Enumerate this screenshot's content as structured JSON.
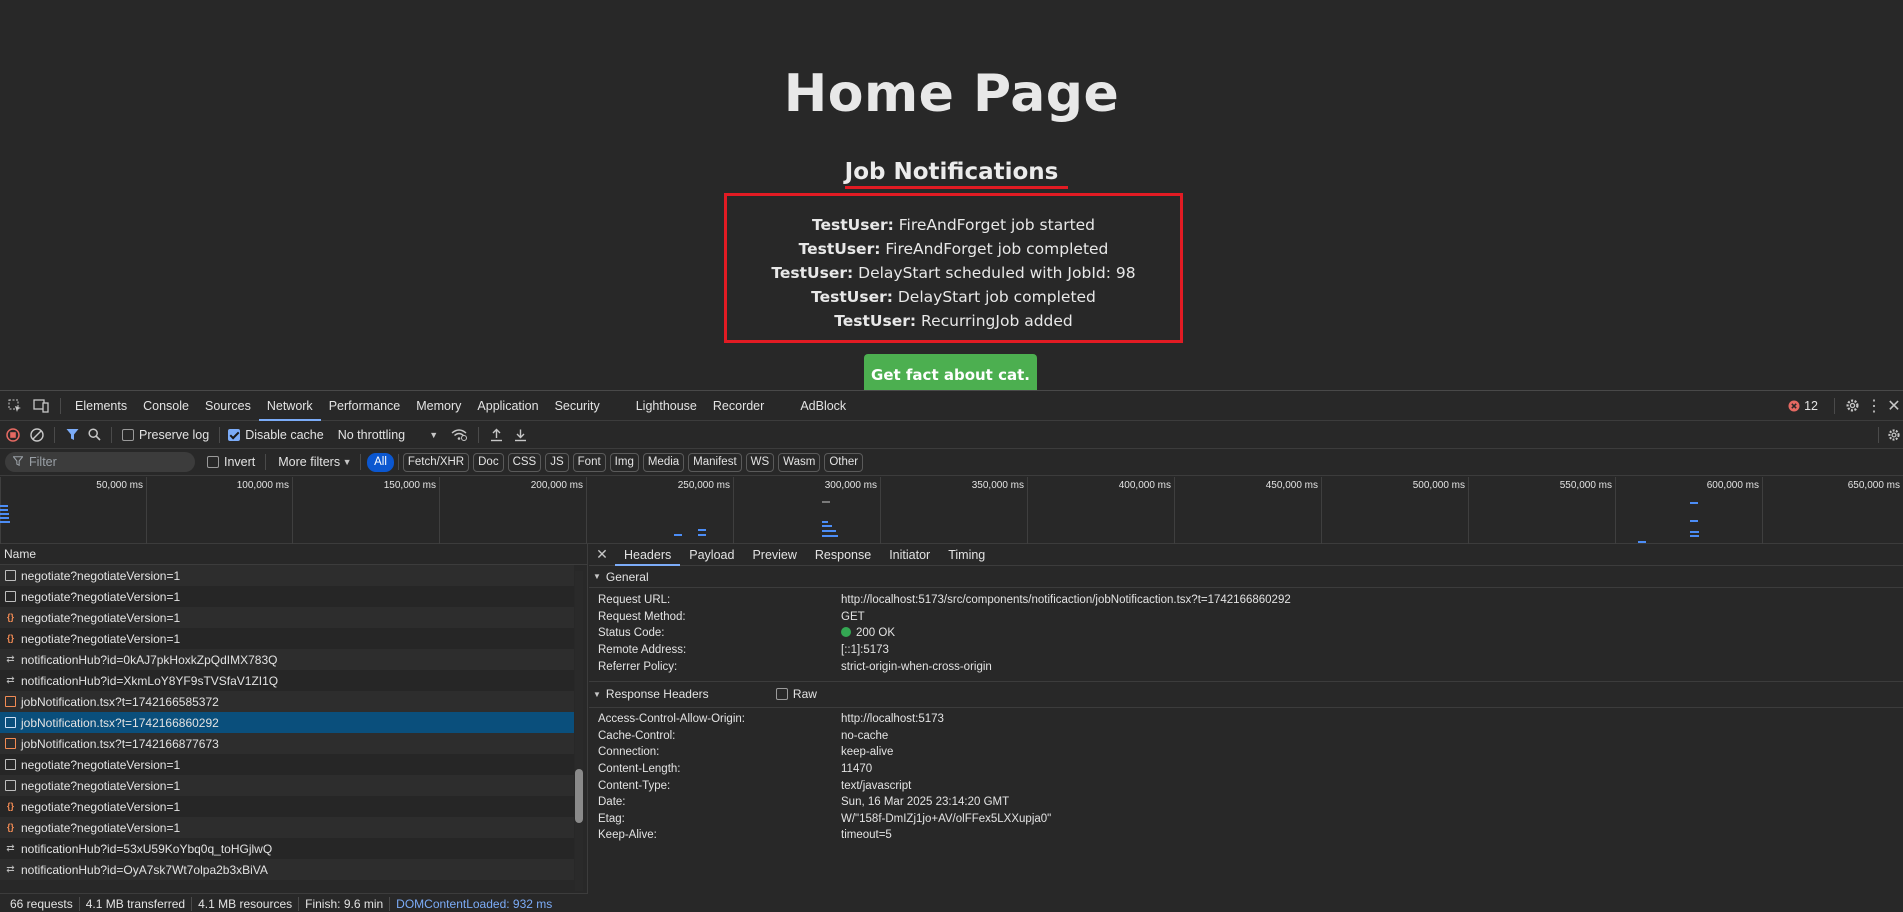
{
  "webpage": {
    "title": "Home Page",
    "subtitle": "Job Notifications",
    "notifications": [
      {
        "user": "TestUser:",
        "message": " FireAndForget job started"
      },
      {
        "user": "TestUser:",
        "message": " FireAndForget job completed"
      },
      {
        "user": "TestUser:",
        "message": " DelayStart scheduled with JobId: 98"
      },
      {
        "user": "TestUser:",
        "message": " DelayStart job completed"
      },
      {
        "user": "TestUser:",
        "message": " RecurringJob added"
      }
    ],
    "cat_button_label": "Get fact about cat.",
    "accent_button_color": "#4caf50",
    "highlight_color": "#e21b23"
  },
  "devtools": {
    "tabs": [
      "Elements",
      "Console",
      "Sources",
      "Network",
      "Performance",
      "Memory",
      "Application",
      "Security",
      "Lighthouse",
      "Recorder",
      "AdBlock"
    ],
    "active_tab": "Network",
    "error_count": "12",
    "toolbar": {
      "preserve_log": "Preserve log",
      "preserve_log_checked": false,
      "disable_cache": "Disable cache",
      "disable_cache_checked": true,
      "throttling": "No throttling"
    },
    "filter": {
      "placeholder": "Filter",
      "invert": "Invert",
      "more_filters": "More filters",
      "types": [
        "All",
        "Fetch/XHR",
        "Doc",
        "CSS",
        "JS",
        "Font",
        "Img",
        "Media",
        "Manifest",
        "WS",
        "Wasm",
        "Other"
      ],
      "active_type": "All"
    },
    "timeline_ticks": [
      "50,000 ms",
      "100,000 ms",
      "150,000 ms",
      "200,000 ms",
      "250,000 ms",
      "300,000 ms",
      "350,000 ms",
      "400,000 ms",
      "450,000 ms",
      "500,000 ms",
      "550,000 ms",
      "600,000 ms",
      "650,000 ms"
    ],
    "request_list": {
      "header": "Name",
      "rows": [
        {
          "name": "negotiate?negotiateVersion=1",
          "icon": "document-icon"
        },
        {
          "name": "negotiate?negotiateVersion=1",
          "icon": "document-icon"
        },
        {
          "name": "negotiate?negotiateVersion=1",
          "icon": "fetch-icon"
        },
        {
          "name": "negotiate?negotiateVersion=1",
          "icon": "fetch-icon"
        },
        {
          "name": "notificationHub?id=0kAJ7pkHoxkZpQdIMX783Q",
          "icon": "websocket-icon"
        },
        {
          "name": "notificationHub?id=XkmLoY8YF9sTVSfaV1ZI1Q",
          "icon": "websocket-icon"
        },
        {
          "name": "jobNotification.tsx?t=1742166585372",
          "icon": "script-icon"
        },
        {
          "name": "jobNotification.tsx?t=1742166860292",
          "icon": "script-icon",
          "selected": true
        },
        {
          "name": "jobNotification.tsx?t=1742166877673",
          "icon": "script-icon"
        },
        {
          "name": "negotiate?negotiateVersion=1",
          "icon": "document-icon"
        },
        {
          "name": "negotiate?negotiateVersion=1",
          "icon": "document-icon"
        },
        {
          "name": "negotiate?negotiateVersion=1",
          "icon": "fetch-icon"
        },
        {
          "name": "negotiate?negotiateVersion=1",
          "icon": "fetch-icon"
        },
        {
          "name": "notificationHub?id=53xU59KoYbq0q_toHGjlwQ",
          "icon": "websocket-icon"
        },
        {
          "name": "notificationHub?id=OyA7sk7Wt7olpa2b3xBiVA",
          "icon": "websocket-icon"
        }
      ]
    },
    "status_bar": {
      "requests": "66 requests",
      "transferred": "4.1 MB transferred",
      "resources": "4.1 MB resources",
      "finish": "Finish: 9.6 min",
      "dom_content_loaded": "DOMContentLoaded: 932 ms"
    },
    "details": {
      "tabs": [
        "Headers",
        "Payload",
        "Preview",
        "Response",
        "Initiator",
        "Timing"
      ],
      "active_tab": "Headers",
      "general_title": "General",
      "general": [
        {
          "key": "Request URL:",
          "value": "http://localhost:5173/src/components/notificaction/jobNotificaction.tsx?t=1742166860292"
        },
        {
          "key": "Request Method:",
          "value": "GET"
        },
        {
          "key": "Status Code:",
          "value": "200 OK"
        },
        {
          "key": "Remote Address:",
          "value": "[::1]:5173"
        },
        {
          "key": "Referrer Policy:",
          "value": "strict-origin-when-cross-origin"
        }
      ],
      "response_headers_title": "Response Headers",
      "raw_label": "Raw",
      "response_headers": [
        {
          "key": "Access-Control-Allow-Origin:",
          "value": "http://localhost:5173"
        },
        {
          "key": "Cache-Control:",
          "value": "no-cache"
        },
        {
          "key": "Connection:",
          "value": "keep-alive"
        },
        {
          "key": "Content-Length:",
          "value": "11470"
        },
        {
          "key": "Content-Type:",
          "value": "text/javascript"
        },
        {
          "key": "Date:",
          "value": "Sun, 16 Mar 2025 23:14:20 GMT"
        },
        {
          "key": "Etag:",
          "value": "W/\"158f-DmIZj1jo+AV/olFFex5LXXupja0\""
        },
        {
          "key": "Keep-Alive:",
          "value": "timeout=5"
        }
      ]
    }
  }
}
